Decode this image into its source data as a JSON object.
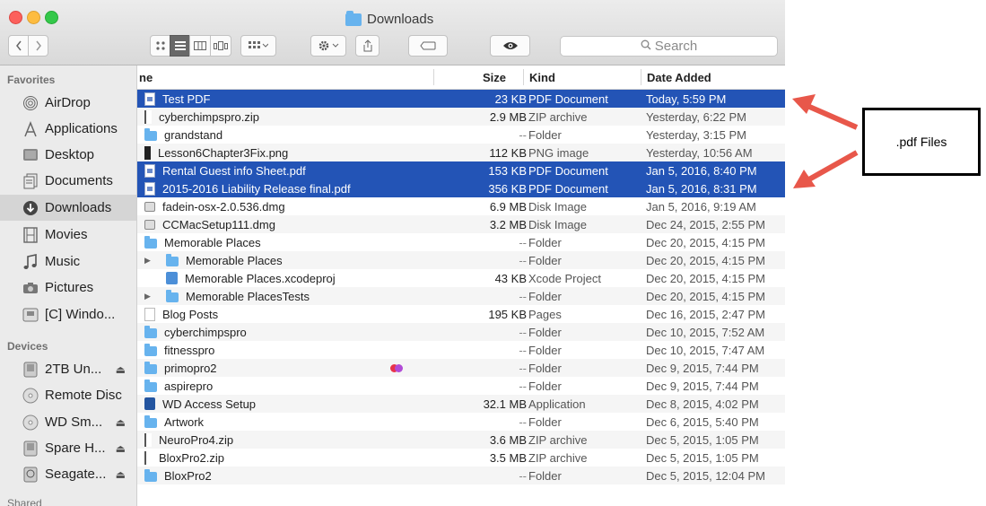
{
  "window": {
    "title": "Downloads",
    "search_placeholder": "Search"
  },
  "toolbar": {
    "back_icon": "chevron-left",
    "forward_icon": "chevron-right",
    "views": [
      "icon-view",
      "list-view",
      "column-view",
      "cover-flow-view"
    ],
    "active_view": "list-view"
  },
  "sidebar": {
    "favorites_label": "Favorites",
    "favorites": [
      {
        "label": "AirDrop",
        "icon": "airdrop-icon"
      },
      {
        "label": "Applications",
        "icon": "applications-icon"
      },
      {
        "label": "Desktop",
        "icon": "desktop-icon"
      },
      {
        "label": "Documents",
        "icon": "documents-icon"
      },
      {
        "label": "Downloads",
        "icon": "downloads-icon",
        "selected": true
      },
      {
        "label": "Movies",
        "icon": "movies-icon"
      },
      {
        "label": "Music",
        "icon": "music-icon"
      },
      {
        "label": "Pictures",
        "icon": "pictures-icon"
      },
      {
        "label": "[C] Windo...",
        "icon": "windows-drive-icon"
      }
    ],
    "devices_label": "Devices",
    "devices": [
      {
        "label": "2TB Un...",
        "icon": "drive-icon",
        "eject": true
      },
      {
        "label": "Remote Disc",
        "icon": "disc-icon",
        "eject": false
      },
      {
        "label": "WD Sm...",
        "icon": "disc-icon",
        "eject": true
      },
      {
        "label": "Spare H...",
        "icon": "drive-icon",
        "eject": true
      },
      {
        "label": "Seagate...",
        "icon": "drive-icon",
        "eject": true
      }
    ],
    "shared_label": "Shared"
  },
  "columns": {
    "name": "ne",
    "size": "Size",
    "kind": "Kind",
    "date": "Date Added"
  },
  "files": [
    {
      "name": "Test PDF",
      "size": "23 KB",
      "kind": "PDF Document",
      "date": "Today, 5:59 PM",
      "icon": "pdf",
      "selected": true,
      "indent": 0
    },
    {
      "name": "cyberchimpspro.zip",
      "size": "2.9 MB",
      "kind": "ZIP archive",
      "date": "Yesterday, 6:22 PM",
      "icon": "zip",
      "indent": 0
    },
    {
      "name": "grandstand",
      "size": "--",
      "kind": "Folder",
      "date": "Yesterday, 3:15 PM",
      "icon": "folder",
      "indent": 0
    },
    {
      "name": "Lesson6Chapter3Fix.png",
      "size": "112 KB",
      "kind": "PNG image",
      "date": "Yesterday, 10:56 AM",
      "icon": "img",
      "indent": 0
    },
    {
      "name": "Rental  Guest info Sheet.pdf",
      "size": "153 KB",
      "kind": "PDF Document",
      "date": "Jan 5, 2016, 8:40 PM",
      "icon": "pdf",
      "selected": true,
      "indent": 0
    },
    {
      "name": "2015-2016 Liability Release final.pdf",
      "size": "356 KB",
      "kind": "PDF Document",
      "date": "Jan 5, 2016, 8:31 PM",
      "icon": "pdf",
      "selected": true,
      "indent": 0
    },
    {
      "name": "fadein-osx-2.0.536.dmg",
      "size": "6.9 MB",
      "kind": "Disk Image",
      "date": "Jan 5, 2016, 9:19 AM",
      "icon": "dmg",
      "indent": 0
    },
    {
      "name": "CCMacSetup111.dmg",
      "size": "3.2 MB",
      "kind": "Disk Image",
      "date": "Dec 24, 2015, 2:55 PM",
      "icon": "dmg",
      "indent": 0
    },
    {
      "name": "Memorable Places",
      "size": "--",
      "kind": "Folder",
      "date": "Dec 20, 2015, 4:15 PM",
      "icon": "folder",
      "indent": 0
    },
    {
      "name": "Memorable Places",
      "size": "--",
      "kind": "Folder",
      "date": "Dec 20, 2015, 4:15 PM",
      "icon": "folder",
      "indent": 1,
      "disclosure": true
    },
    {
      "name": "Memorable Places.xcodeproj",
      "size": "43 KB",
      "kind": "Xcode Project",
      "date": "Dec 20, 2015, 4:15 PM",
      "icon": "xc",
      "indent": 1
    },
    {
      "name": "Memorable PlacesTests",
      "size": "--",
      "kind": "Folder",
      "date": "Dec 20, 2015, 4:15 PM",
      "icon": "folder",
      "indent": 1,
      "disclosure": true
    },
    {
      "name": "Blog Posts",
      "size": "195 KB",
      "kind": "Pages",
      "date": "Dec 16, 2015, 2:47 PM",
      "icon": "pages",
      "indent": 0
    },
    {
      "name": "cyberchimpspro",
      "size": "--",
      "kind": "Folder",
      "date": "Dec 10, 2015, 7:52 AM",
      "icon": "folder",
      "indent": 0
    },
    {
      "name": "fitnesspro",
      "size": "--",
      "kind": "Folder",
      "date": "Dec 10, 2015, 7:47 AM",
      "icon": "folder",
      "indent": 0
    },
    {
      "name": "primopro2",
      "size": "--",
      "kind": "Folder",
      "date": "Dec 9, 2015, 7:44 PM",
      "icon": "folder",
      "indent": 0,
      "tags": [
        "#e8344a",
        "#b14bd6"
      ]
    },
    {
      "name": "aspirepro",
      "size": "--",
      "kind": "Folder",
      "date": "Dec 9, 2015, 7:44 PM",
      "icon": "folder",
      "indent": 0
    },
    {
      "name": "WD Access Setup",
      "size": "32.1 MB",
      "kind": "Application",
      "date": "Dec 8, 2015, 4:02 PM",
      "icon": "app",
      "indent": 0
    },
    {
      "name": "Artwork",
      "size": "--",
      "kind": "Folder",
      "date": "Dec 6, 2015, 5:40 PM",
      "icon": "folder",
      "indent": 0
    },
    {
      "name": "NeuroPro4.zip",
      "size": "3.6 MB",
      "kind": "ZIP archive",
      "date": "Dec 5, 2015, 1:05 PM",
      "icon": "zip",
      "indent": 0
    },
    {
      "name": "BloxPro2.zip",
      "size": "3.5 MB",
      "kind": "ZIP archive",
      "date": "Dec 5, 2015, 1:05 PM",
      "icon": "zip",
      "indent": 0
    },
    {
      "name": "BloxPro2",
      "size": "--",
      "kind": "Folder",
      "date": "Dec 5, 2015, 12:04 PM",
      "icon": "folder",
      "indent": 0
    }
  ],
  "annotation": {
    "label": ".pdf Files",
    "arrow_color": "#e8574a"
  },
  "colors": {
    "selection": "#2354b6",
    "folder": "#67b3ee"
  }
}
